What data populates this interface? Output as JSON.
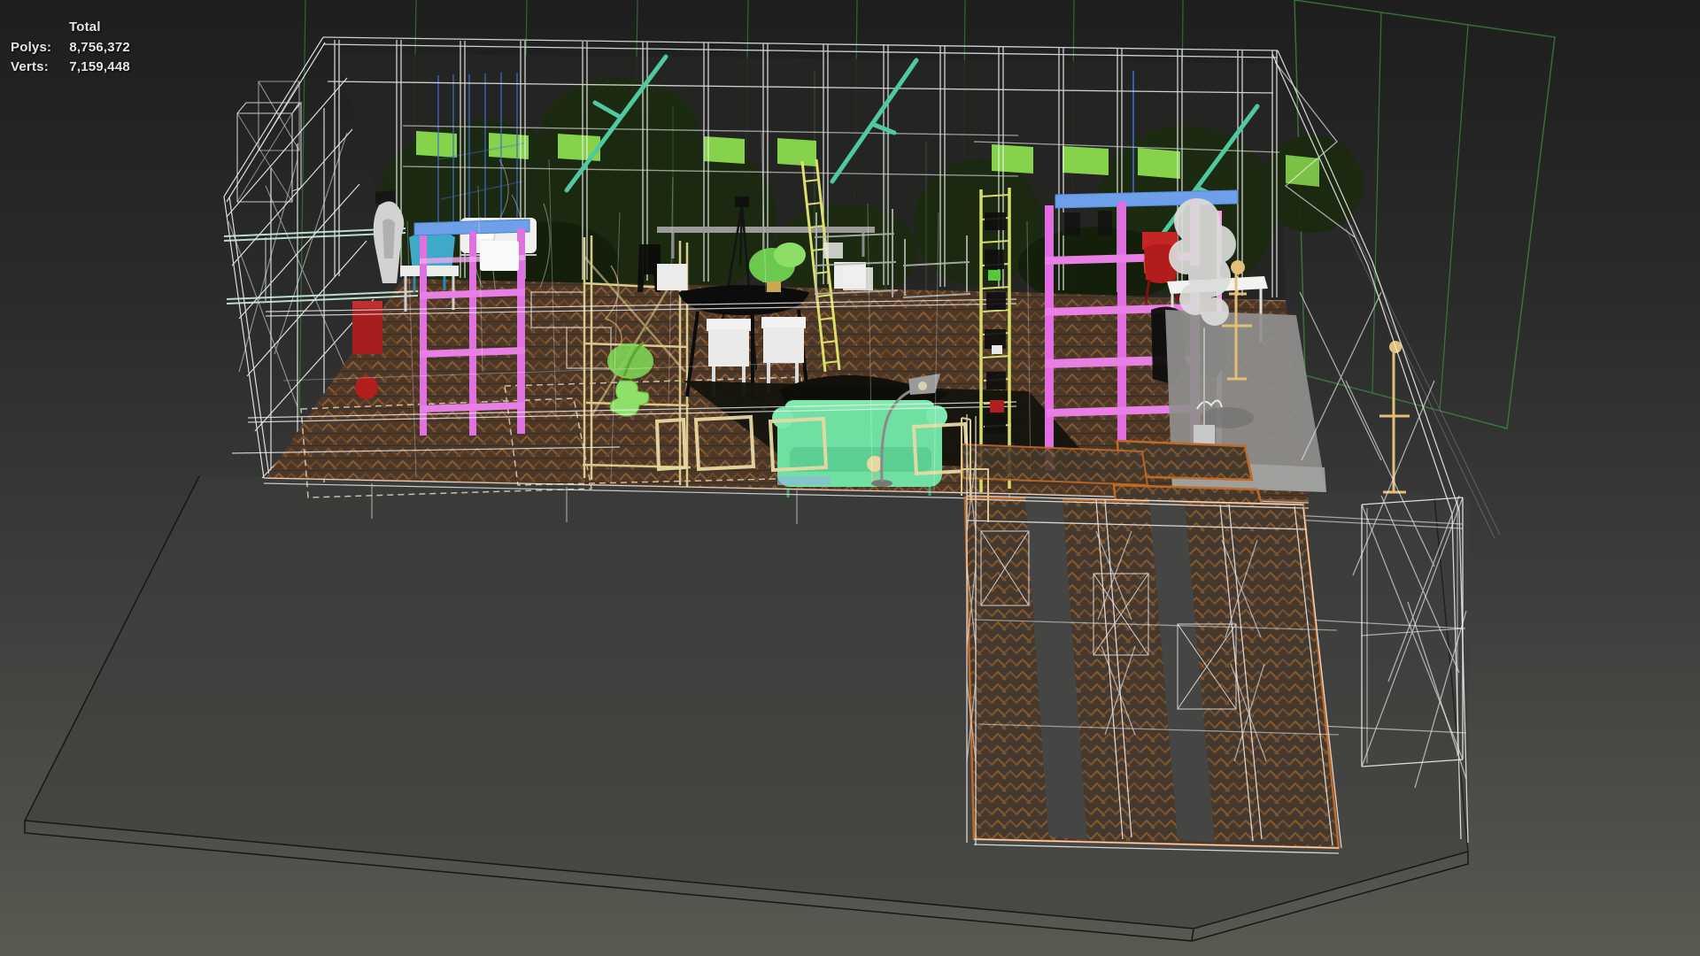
{
  "stats_overlay": {
    "title": "Total",
    "rows": [
      {
        "label": "Polys:",
        "value": "8,756,372"
      },
      {
        "label": "Verts:",
        "value": "7,159,448"
      }
    ]
  },
  "viewport": {
    "type": "3d-perspective-wireframe-view",
    "scene_objects": [
      "green-reference-plane-grid",
      "ground-platform-slab",
      "apartment-bounding-wireframes",
      "stud-frame-back-wall",
      "green-window-panes",
      "outdoor-foliage",
      "herringbone-wood-floor",
      "bedroom-magenta-shelf-unit",
      "study-magenta-shelf-unit",
      "blue-shelf-top-bars",
      "mint-green-sofa",
      "dark-area-rug",
      "cream-frame-panels",
      "dining-table-black",
      "white-dining-chairs",
      "teal-armchair",
      "white-bed",
      "red-cabinet",
      "gray-statue",
      "tan-open-bookcase",
      "yellow-ladder-shelf",
      "leaning-yellow-ladder",
      "black-tripod-lamp",
      "arc-floor-lamp",
      "green-parrot",
      "teal-branches",
      "white-faux-plant",
      "red-desk-chair",
      "white-desk",
      "tan-floor-lamps",
      "gray-concrete-rug",
      "orange-bordered-rugs",
      "right-wing-corridor-walls",
      "x-braced-wireframe-walls"
    ],
    "palette": {
      "background_top": "#1e1e1e",
      "background_bottom": "#5a5a53",
      "wireframe_white": "#f0f0f0",
      "grid_green": "#3a7d3c",
      "plane_green": "#3f8f42",
      "window_green": "#86d24b",
      "foliage_dark_green": "#1b2a0f",
      "floor_brown": "#4c3828",
      "floor_stripe": "#8a5c34",
      "floor_border_orange": "#c06a28",
      "shelf_magenta": "#e06ee0",
      "bar_blue": "#6f9fe8",
      "branch_teal": "#4ec9a0",
      "sofa_mint": "#6fdfa2",
      "ladder_yellow": "#d6dc6e",
      "frame_tan": "#e7d9a4",
      "rug_gray": "#8f8f8d",
      "chair_red": "#b31c1c",
      "armchair_teal": "#3fa9c8",
      "lamp_tan": "#e2c078",
      "statue_gray": "#d2d2d0",
      "outline_dark": "#161616"
    }
  }
}
